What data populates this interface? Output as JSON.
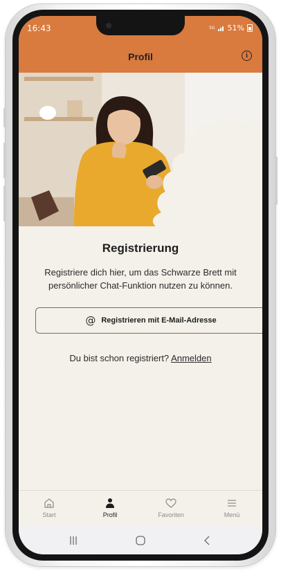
{
  "status_bar": {
    "time": "16:43",
    "network": "5G",
    "battery": "51%"
  },
  "header": {
    "title": "Profil",
    "info_icon": "info-icon",
    "background_color": "#d97a3e"
  },
  "registration": {
    "title": "Registrierung",
    "description": "Registriere dich hier, um das Schwarze Brett mit persönlicher Chat-Funktion nutzen zu können.",
    "email_button_icon": "at-icon",
    "email_button_label": "Registrieren mit E-Mail-Adresse",
    "already_registered_text": "Du bist schon registriert?",
    "login_link": "Anmelden"
  },
  "tab_bar": {
    "active": "profil",
    "items": [
      {
        "id": "start",
        "label": "Start",
        "icon": "home-icon"
      },
      {
        "id": "profil",
        "label": "Profil",
        "icon": "person-icon"
      },
      {
        "id": "favoriten",
        "label": "Favoriten",
        "icon": "heart-icon"
      },
      {
        "id": "menu",
        "label": "Menü",
        "icon": "menu-icon"
      }
    ]
  },
  "system_nav": [
    "recents-icon",
    "home-circle-icon",
    "back-chevron-icon"
  ]
}
